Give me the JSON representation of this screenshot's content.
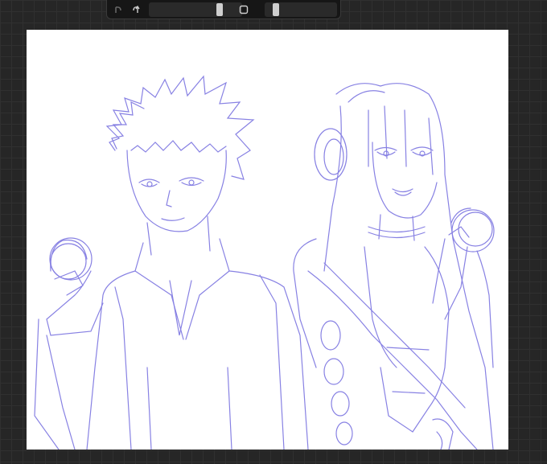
{
  "app": {
    "accent": "#7b74e0"
  },
  "toolbar": {
    "undo_icon": "undo-arrow-icon",
    "redo_icon": "redo-arrow-icon",
    "modify_icon": "square-modify-icon",
    "brush_size_level": 0.78,
    "opacity_level": 0.12
  },
  "canvas": {
    "background": "#ffffff",
    "stroke_color": "#7b74e0"
  }
}
